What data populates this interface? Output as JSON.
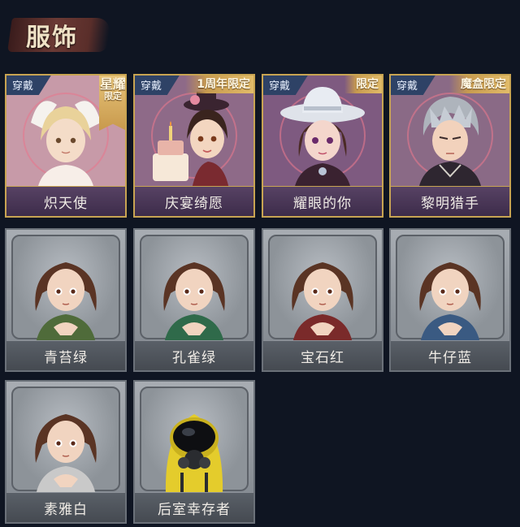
{
  "section_title": "服饰",
  "special_items": [
    {
      "name": "炽天使",
      "wear_tag": "穿戴",
      "limited_main": "星耀",
      "limited_sub": "限定",
      "icon": "seraph-portrait-icon"
    },
    {
      "name": "庆宴绮愿",
      "wear_tag": "穿戴",
      "limited": "1周年限定",
      "icon": "celebration-portrait-icon"
    },
    {
      "name": "耀眼的你",
      "wear_tag": "穿戴",
      "limited": "限定",
      "icon": "cowgirl-portrait-icon"
    },
    {
      "name": "黎明猎手",
      "wear_tag": "穿戴",
      "limited": "魔盒限定",
      "icon": "dawn-hunter-portrait-icon"
    }
  ],
  "basic_items": [
    {
      "name": "青苔绿",
      "color": "#4f6b3a",
      "icon": "girl-portrait-icon"
    },
    {
      "name": "孔雀绿",
      "color": "#2f6a4a",
      "icon": "girl-portrait-icon"
    },
    {
      "name": "宝石红",
      "color": "#7a2a2a",
      "icon": "girl-portrait-icon"
    },
    {
      "name": "牛仔蓝",
      "color": "#3a5a82",
      "icon": "girl-portrait-icon"
    },
    {
      "name": "素雅白",
      "color": "#c9c9c9",
      "icon": "girl-portrait-icon"
    },
    {
      "name": "后室幸存者",
      "color": "#e4cc2c",
      "icon": "gasmask-survivor-icon"
    }
  ]
}
